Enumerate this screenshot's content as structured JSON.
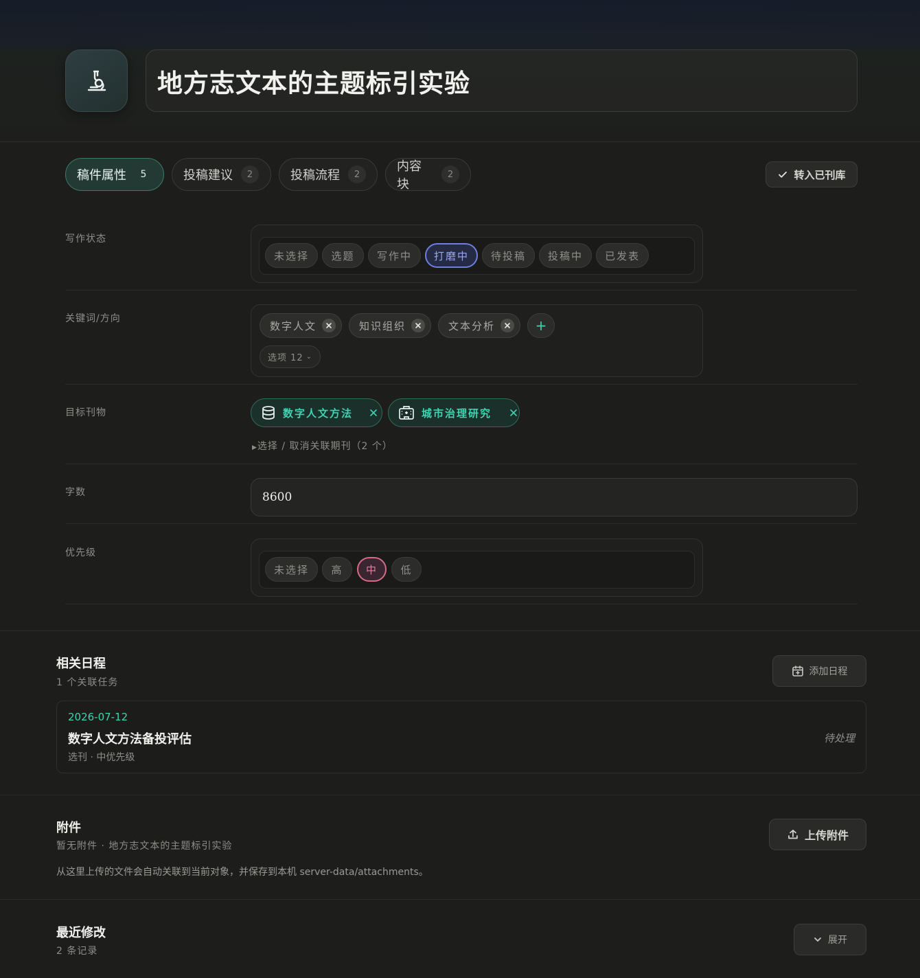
{
  "title": "地方志文本的主题标引实验",
  "tabs": [
    {
      "label": "稿件属性",
      "count": "5"
    },
    {
      "label": "投稿建议",
      "count": "2"
    },
    {
      "label": "投稿流程",
      "count": "2"
    },
    {
      "label": "内容块",
      "count": "2"
    }
  ],
  "move_button": "转入已刊库",
  "fields": {
    "status_label": "写作状态",
    "status_options": [
      "未选择",
      "选题",
      "写作中",
      "打磨中",
      "待投稿",
      "投稿中",
      "已发表"
    ],
    "status_selected": "打磨中",
    "keywords_label": "关键词/方向",
    "keywords": [
      "数字人文",
      "知识组织",
      "文本分析"
    ],
    "keywords_more": "选项 12",
    "journal_label": "目标刊物",
    "journals": [
      "数字人文方法",
      "城市治理研究"
    ],
    "journal_toggle": "选择 / 取消关联期刊（2 个）",
    "wordcount_label": "字数",
    "wordcount_value": "8600",
    "priority_label": "优先级",
    "priority_options": [
      "未选择",
      "高",
      "中",
      "低"
    ],
    "priority_selected": "中"
  },
  "schedule": {
    "title": "相关日程",
    "subtitle": "1 个关联任务",
    "add_button": "添加日程",
    "task": {
      "date": "2026-07-12",
      "name": "数字人文方法备投评估",
      "meta": "选刊 · 中优先级",
      "status": "待处理"
    }
  },
  "attachments": {
    "title": "附件",
    "subtitle": "暂无附件 · 地方志文本的主题标引实验",
    "upload_button": "上传附件",
    "note": "从这里上传的文件会自动关联到当前对象，并保存到本机 server-data/attachments。"
  },
  "recent": {
    "title": "最近修改",
    "subtitle": "2 条记录",
    "expand_button": "展开"
  },
  "colors": {
    "accent_green": "#3fd3b1",
    "selected_blue": "#6f7fe0",
    "selected_pink": "#d86a8a"
  }
}
